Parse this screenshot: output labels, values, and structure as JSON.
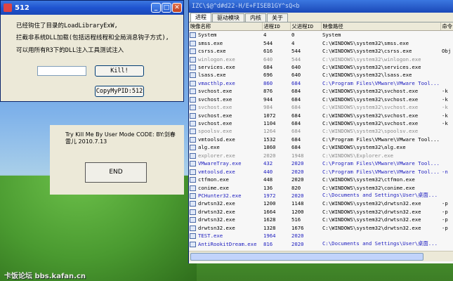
{
  "win1": {
    "title": "512",
    "min": "_",
    "max": "□",
    "close": "✕",
    "msg1": "已经钩住了目录的LoadLibraryExW,",
    "msg2": "拦截非系统DLL加载(包括远程线程和全局消息钩子方式),",
    "msg3": "可以用所有R3下的DLL注入工具测试注入",
    "pid_value": "",
    "kill_label": "Kill!",
    "copy_label": "CopyMyPID:512"
  },
  "win2": {
    "text": "Try Kill Me By User Mode    CODE: BY:剑春雷儿 2010.7.13",
    "end_label": "END"
  },
  "win3": {
    "title": "IZC\\$@^d#d22-H/E+FISEB1GY^sQ<b",
    "tabs": [
      "进程",
      "驱动模块",
      "内核",
      "关于"
    ],
    "columns": [
      "映像名称",
      "进程ID",
      "父进程ID",
      "映像路径",
      "命令"
    ],
    "rows": [
      {
        "name": "System",
        "pid": "4",
        "ppid": "0",
        "path": "System",
        "cmd": "",
        "style": ""
      },
      {
        "name": "smss.exe",
        "pid": "544",
        "ppid": "4",
        "path": "C:\\WINDOWS\\system32\\smss.exe",
        "cmd": "",
        "style": ""
      },
      {
        "name": "csrss.exe",
        "pid": "616",
        "ppid": "544",
        "path": "C:\\WINDOWS\\system32\\csrss.exe",
        "cmd": "Obj",
        "style": ""
      },
      {
        "name": "winlogon.exe",
        "pid": "640",
        "ppid": "544",
        "path": "C:\\WINDOWS\\system32\\winlogon.exe",
        "cmd": "",
        "style": "grey"
      },
      {
        "name": "services.exe",
        "pid": "684",
        "ppid": "640",
        "path": "C:\\WINDOWS\\system32\\services.exe",
        "cmd": "",
        "style": ""
      },
      {
        "name": "lsass.exe",
        "pid": "696",
        "ppid": "640",
        "path": "C:\\WINDOWS\\system32\\lsass.exe",
        "cmd": "",
        "style": ""
      },
      {
        "name": "vmacthlp.exe",
        "pid": "860",
        "ppid": "684",
        "path": "C:\\Program Files\\VMware\\VMware Tool...",
        "cmd": "",
        "style": "blue"
      },
      {
        "name": "svchost.exe",
        "pid": "876",
        "ppid": "684",
        "path": "C:\\WINDOWS\\system32\\svchost.exe",
        "cmd": "-k",
        "style": ""
      },
      {
        "name": "svchost.exe",
        "pid": "944",
        "ppid": "684",
        "path": "C:\\WINDOWS\\system32\\svchost.exe",
        "cmd": "-k",
        "style": ""
      },
      {
        "name": "svchost.exe",
        "pid": "984",
        "ppid": "684",
        "path": "C:\\WINDOWS\\system32\\svchost.exe",
        "cmd": "-k",
        "style": "grey"
      },
      {
        "name": "svchost.exe",
        "pid": "1072",
        "ppid": "684",
        "path": "C:\\WINDOWS\\system32\\svchost.exe",
        "cmd": "-k",
        "style": ""
      },
      {
        "name": "svchost.exe",
        "pid": "1104",
        "ppid": "684",
        "path": "C:\\WINDOWS\\system32\\svchost.exe",
        "cmd": "-k",
        "style": ""
      },
      {
        "name": "spoolsv.exe",
        "pid": "1264",
        "ppid": "684",
        "path": "C:\\WINDOWS\\system32\\spoolsv.exe",
        "cmd": "",
        "style": "grey"
      },
      {
        "name": "vmtoolsd.exe",
        "pid": "1532",
        "ppid": "684",
        "path": "C:\\Program Files\\VMware\\VMware Tool...",
        "cmd": "",
        "style": ""
      },
      {
        "name": "alg.exe",
        "pid": "1860",
        "ppid": "684",
        "path": "C:\\WINDOWS\\system32\\alg.exe",
        "cmd": "",
        "style": ""
      },
      {
        "name": "explorer.exe",
        "pid": "2020",
        "ppid": "1948",
        "path": "C:\\WINDOWS\\Explorer.exe",
        "cmd": "",
        "style": "grey"
      },
      {
        "name": "VMwareTray.exe",
        "pid": "432",
        "ppid": "2020",
        "path": "C:\\Program Files\\VMware\\VMware Tool...",
        "cmd": "",
        "style": "blue"
      },
      {
        "name": "vmtoolsd.exe",
        "pid": "440",
        "ppid": "2020",
        "path": "C:\\Program Files\\VMware\\VMware Tool...",
        "cmd": "-n",
        "style": "blue"
      },
      {
        "name": "ctfmon.exe",
        "pid": "448",
        "ppid": "2020",
        "path": "C:\\WINDOWS\\system32\\ctfmon.exe",
        "cmd": "",
        "style": ""
      },
      {
        "name": "conime.exe",
        "pid": "136",
        "ppid": "820",
        "path": "C:\\WINDOWS\\system32\\conime.exe",
        "cmd": "",
        "style": ""
      },
      {
        "name": "PCHunter32.exe",
        "pid": "1972",
        "ppid": "2020",
        "path": "C:\\Documents and Settings\\User\\桌面...",
        "cmd": "",
        "style": "blue"
      },
      {
        "name": "drwtsn32.exe",
        "pid": "1200",
        "ppid": "1148",
        "path": "C:\\WINDOWS\\system32\\drwtsn32.exe",
        "cmd": "-p",
        "style": ""
      },
      {
        "name": "drwtsn32.exe",
        "pid": "1664",
        "ppid": "1200",
        "path": "C:\\WINDOWS\\system32\\drwtsn32.exe",
        "cmd": "-p",
        "style": ""
      },
      {
        "name": "drwtsn32.exe",
        "pid": "1628",
        "ppid": "516",
        "path": "C:\\WINDOWS\\system32\\drwtsn32.exe",
        "cmd": "-p",
        "style": ""
      },
      {
        "name": "drwtsn32.exe",
        "pid": "1328",
        "ppid": "1676",
        "path": "C:\\WINDOWS\\system32\\drwtsn32.exe",
        "cmd": "-p",
        "style": ""
      },
      {
        "name": "TEST.exe",
        "pid": "1964",
        "ppid": "2020",
        "path": "",
        "cmd": "",
        "style": "blue"
      },
      {
        "name": "AntiRookitDream.exe",
        "pid": "816",
        "ppid": "2020",
        "path": "C:\\Documents and Settings\\User\\桌面...",
        "cmd": "",
        "style": "blue"
      }
    ]
  },
  "watermark": "卡饭论坛 bbs.kafan.cn"
}
